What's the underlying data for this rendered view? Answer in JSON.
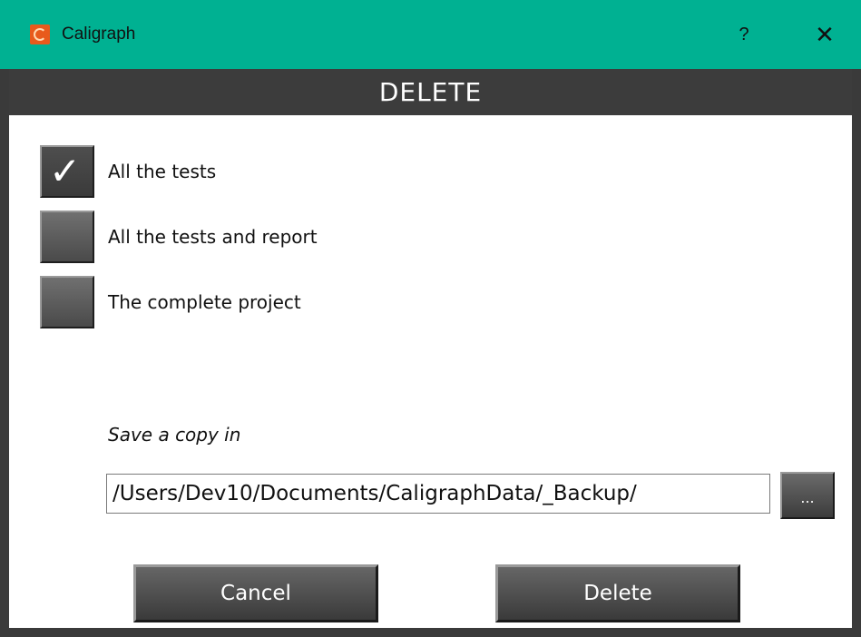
{
  "window": {
    "title": "Caligraph",
    "help_label": "?",
    "close_label": "✕",
    "app_icon": "caligraph-logo-icon"
  },
  "dialog": {
    "header": "DELETE",
    "options": [
      {
        "label": "All the tests",
        "checked": true
      },
      {
        "label": "All the tests and report",
        "checked": false
      },
      {
        "label": "The complete project",
        "checked": false
      }
    ],
    "save_label": "Save a copy in",
    "path_value": "/Users/Dev10/Documents/CaligraphData/_Backup/",
    "browse_label": "...",
    "cancel_label": "Cancel",
    "delete_label": "Delete"
  },
  "colors": {
    "titlebar": "#00b192",
    "header": "#3c3c3c",
    "button": "#4a4a4a"
  }
}
